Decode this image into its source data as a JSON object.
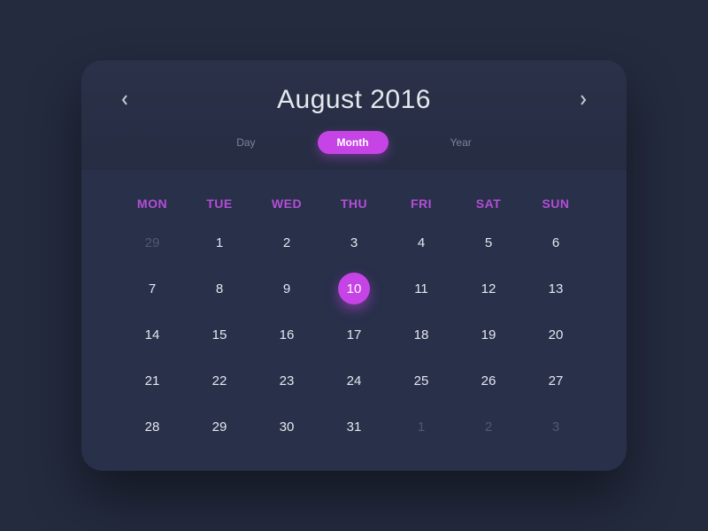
{
  "colors": {
    "accent": "#c644e6",
    "bg": "#242b3f",
    "card": "#28304a"
  },
  "header": {
    "title": "August 2016"
  },
  "tabs": [
    "Day",
    "Month",
    "Year"
  ],
  "active_tab": 1,
  "daynames": [
    "MON",
    "TUE",
    "WED",
    "THU",
    "FRI",
    "SAT",
    "SUN"
  ],
  "selected_day": 10,
  "weeks": [
    [
      {
        "n": 29,
        "other": true
      },
      {
        "n": 1
      },
      {
        "n": 2
      },
      {
        "n": 3
      },
      {
        "n": 4
      },
      {
        "n": 5
      },
      {
        "n": 6
      }
    ],
    [
      {
        "n": 7
      },
      {
        "n": 8
      },
      {
        "n": 9
      },
      {
        "n": 10,
        "selected": true
      },
      {
        "n": 11
      },
      {
        "n": 12
      },
      {
        "n": 13
      }
    ],
    [
      {
        "n": 14
      },
      {
        "n": 15
      },
      {
        "n": 16
      },
      {
        "n": 17
      },
      {
        "n": 18
      },
      {
        "n": 19
      },
      {
        "n": 20
      }
    ],
    [
      {
        "n": 21
      },
      {
        "n": 22
      },
      {
        "n": 23
      },
      {
        "n": 24
      },
      {
        "n": 25
      },
      {
        "n": 26
      },
      {
        "n": 27
      }
    ],
    [
      {
        "n": 28
      },
      {
        "n": 29
      },
      {
        "n": 30
      },
      {
        "n": 31
      },
      {
        "n": 1,
        "other": true
      },
      {
        "n": 2,
        "other": true
      },
      {
        "n": 3,
        "other": true
      }
    ]
  ]
}
